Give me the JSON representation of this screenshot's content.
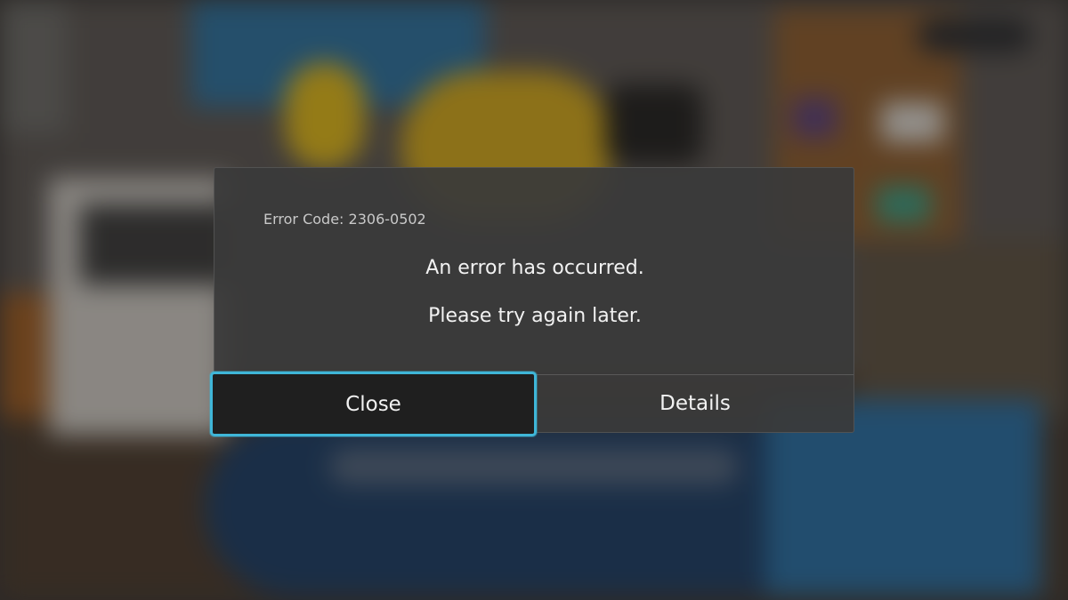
{
  "dialog": {
    "error_code": "Error Code: 2306-0502",
    "message_line1": "An error has occurred.",
    "message_line2": "Please try again later."
  },
  "buttons": {
    "close_label": "Close",
    "details_label": "Details"
  },
  "colors": {
    "focus_outline": "#3fb6d8",
    "dialog_bg": "#3a3a3a",
    "text": "#f2f2f2"
  }
}
